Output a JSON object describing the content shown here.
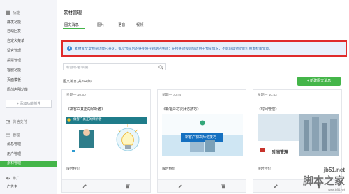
{
  "sidebar": {
    "groups": [
      {
        "title": "功能",
        "items": [
          "群发功能",
          "自动回复",
          "自定义菜单",
          "留言管理",
          "投票管理",
          "客服功能",
          "页面模板",
          "原创声明功能"
        ]
      },
      {
        "title": "微信支付",
        "items": []
      },
      {
        "title": "管理",
        "items": [
          "消息管理",
          "用户管理",
          "素材管理"
        ]
      },
      {
        "title": "推广",
        "items": [
          "广告主"
        ]
      }
    ],
    "add_plugin": "+ 添加功能插件",
    "active_item": "素材管理"
  },
  "main": {
    "title": "素材管理",
    "tabs": [
      "图文消息",
      "图片",
      "语音",
      "视频"
    ],
    "notice": "素材库文章预览功能已升级，每次预览后的链接将在短期内失效；链接失效规则仅适用于预览情况，不影响其他功能引用素材库文章。",
    "search_placeholder": "标题/作者/摘要",
    "count_label": "图文消息(共264条)",
    "new_button": "+ 新建图文消息",
    "cards": [
      {
        "date": "星期一 10:50",
        "title": "《做客户真正的倾听者》",
        "sub": "限时特价",
        "thumb_text": "做客户真正的倾听者"
      },
      {
        "date": "星期一 10:44",
        "title": "《新客户初次拜访技巧》",
        "sub": "限时特价",
        "thumb_text": "新客户初次拜访技巧"
      },
      {
        "date": "星期一 10:43",
        "title": "《时间管理》",
        "sub": "限时特价",
        "thumb_text": "时间管理"
      }
    ]
  },
  "watermark": {
    "main": "脚本之家",
    "site": "jb51.net",
    "site_sub": "www.jb51.net"
  },
  "colors": {
    "accent": "#44b549",
    "notice_border": "#e02b2b",
    "notice_bg": "#e9f0fb",
    "info_blue": "#3a8bd8"
  }
}
